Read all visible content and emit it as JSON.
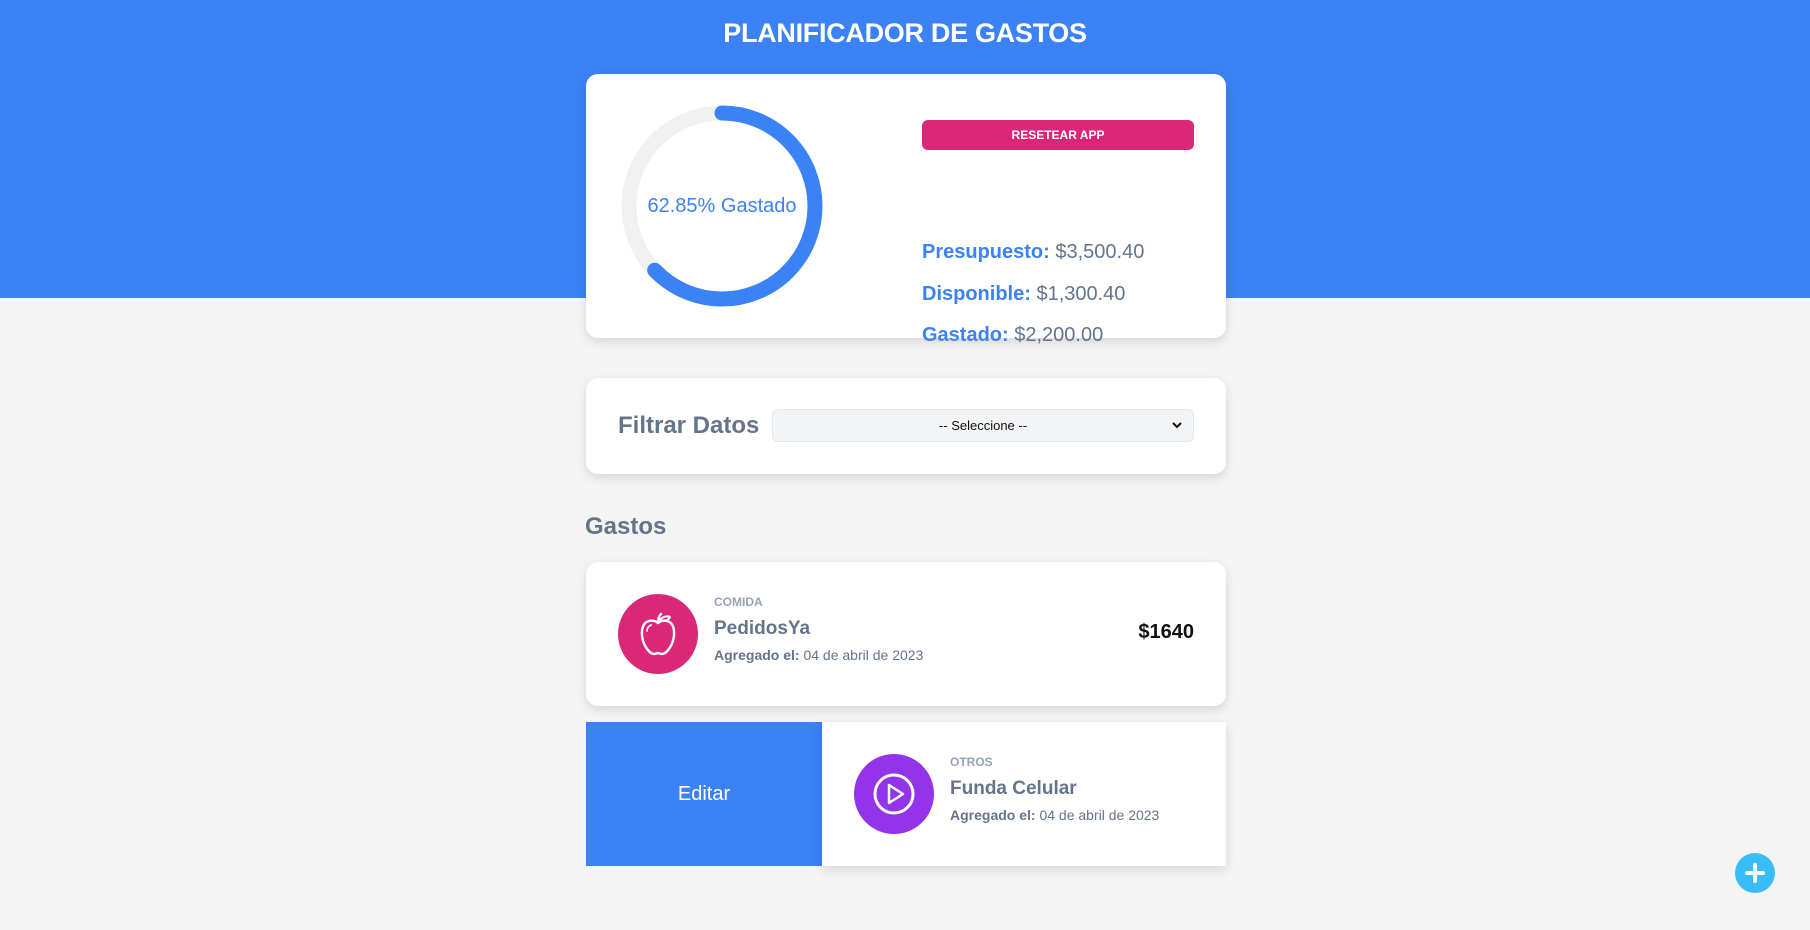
{
  "header": {
    "title": "PLANIFICADOR DE GASTOS"
  },
  "budget": {
    "percent_spent": 62.85,
    "progress_text": "62.85% Gastado",
    "reset_label": "RESETEAR APP",
    "presupuesto_label": "Presupuesto:",
    "presupuesto_value": "$3,500.40",
    "disponible_label": "Disponible:",
    "disponible_value": "$1,300.40",
    "gastado_label": "Gastado:",
    "gastado_value": "$2,200.00"
  },
  "filter": {
    "label": "Filtrar Datos",
    "selected": "-- Seleccione --"
  },
  "expenses_title": "Gastos",
  "expenses": [
    {
      "category": "COMIDA",
      "name": "PedidosYa",
      "date_label": "Agregado el:",
      "date": "04 de abril de 2023",
      "amount": "$1640",
      "icon": "apple-icon"
    },
    {
      "category": "OTROS",
      "name": "Funda Celular",
      "date_label": "Agregado el:",
      "date": "04 de abril de 2023",
      "icon": "play-icon"
    }
  ],
  "swipe_action": {
    "edit_label": "Editar"
  },
  "colors": {
    "primary": "#3b82f6",
    "reset": "#db2777",
    "food": "#db2777",
    "other": "#9333ea",
    "fab": "#38bdf8"
  }
}
